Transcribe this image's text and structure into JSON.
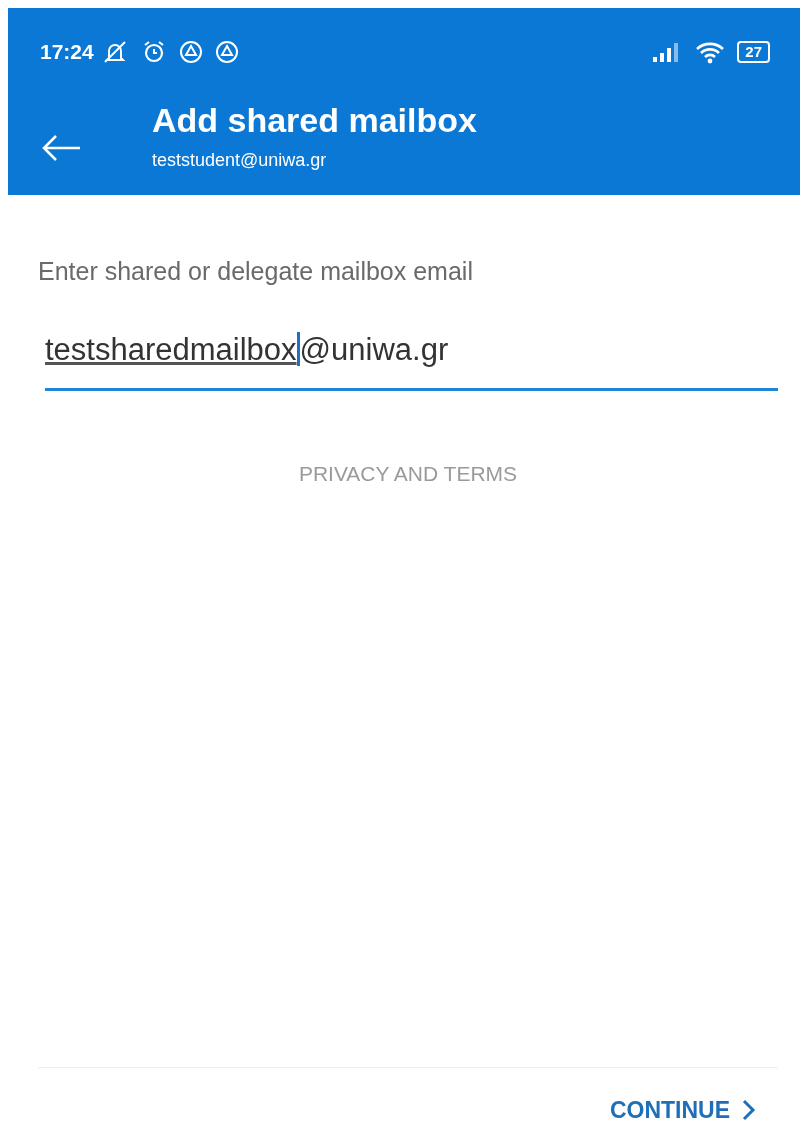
{
  "status_bar": {
    "time": "17:24",
    "battery": "27"
  },
  "header": {
    "title": "Add shared mailbox",
    "subtitle": "teststudent@uniwa.gr"
  },
  "mailbox_field": {
    "label": "Enter shared or delegate mailbox email",
    "value": {
      "composing": "testsharedmailbox",
      "rest": "@uniwa.gr"
    },
    "focused": true
  },
  "privacy_link": "PRIVACY AND TERMS",
  "continue_button": "CONTINUE"
}
